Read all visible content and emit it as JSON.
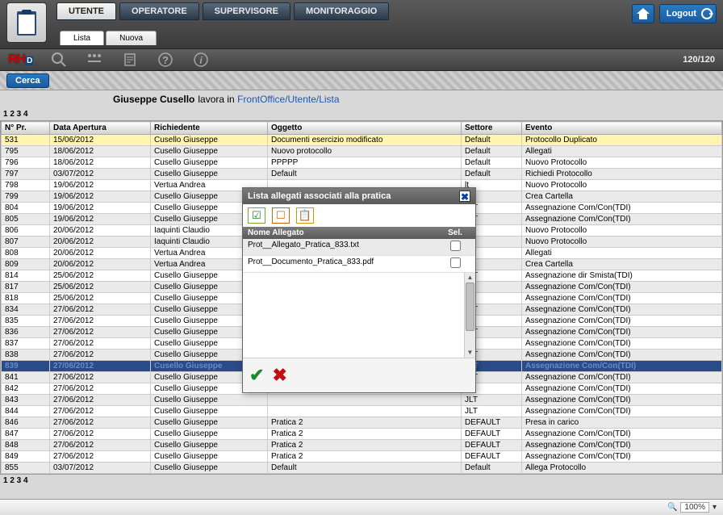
{
  "header": {
    "tabs": [
      "UTENTE",
      "OPERATORE",
      "SUPERVISORE",
      "MONITORAGGIO"
    ],
    "active_tab": 0,
    "logout": "Logout"
  },
  "sub_tabs": {
    "items": [
      "Lista",
      "Nuova"
    ],
    "active": 0
  },
  "rh_logo": {
    "a": "RH",
    "b": "D"
  },
  "counter": "120/120",
  "cerca": "Cerca",
  "context": {
    "user": "Giuseppe Cusello",
    "text": "lavora in",
    "path": "FrontOffice/Utente/Lista"
  },
  "pagination": "1 2 3 4",
  "columns": [
    "N° Pr.",
    "Data Apertura",
    "Richiedente",
    "Oggetto",
    "Settore",
    "Evento"
  ],
  "rows": [
    {
      "n": "531",
      "d": "15/06/2012",
      "r": "Cusello Giuseppe",
      "o": "Documenti esercizio modificato",
      "s": "Default",
      "e": "Protocollo Duplicato",
      "hl": "yellow"
    },
    {
      "n": "795",
      "d": "18/06/2012",
      "r": "Cusello Giuseppe",
      "o": "Nuovo protocollo",
      "s": "Default",
      "e": "Allegati"
    },
    {
      "n": "796",
      "d": "18/06/2012",
      "r": "Cusello Giuseppe",
      "o": "PPPPP",
      "s": "Default",
      "e": "Nuovo Protocollo"
    },
    {
      "n": "797",
      "d": "03/07/2012",
      "r": "Cusello Giuseppe",
      "o": "Default",
      "s": "Default",
      "e": "Richiedi Protocollo"
    },
    {
      "n": "798",
      "d": "19/06/2012",
      "r": "Vertua Andrea",
      "o": "",
      "s": "lt",
      "e": "Nuovo Protocollo"
    },
    {
      "n": "799",
      "d": "19/06/2012",
      "r": "Cusello Giuseppe",
      "o": "",
      "s": "lt",
      "e": "Crea Cartella"
    },
    {
      "n": "804",
      "d": "19/06/2012",
      "r": "Cusello Giuseppe",
      "o": "",
      "s": "JLT",
      "e": "Assegnazione Com/Con(TDI)"
    },
    {
      "n": "805",
      "d": "19/06/2012",
      "r": "Cusello Giuseppe",
      "o": "",
      "s": "JLT",
      "e": "Assegnazione Com/Con(TDI)"
    },
    {
      "n": "806",
      "d": "20/06/2012",
      "r": "Iaquinti Claudio",
      "o": "",
      "s": "lt",
      "e": "Nuovo Protocollo"
    },
    {
      "n": "807",
      "d": "20/06/2012",
      "r": "Iaquinti Claudio",
      "o": "",
      "s": "lt",
      "e": "Nuovo Protocollo"
    },
    {
      "n": "808",
      "d": "20/06/2012",
      "r": "Vertua Andrea",
      "o": "",
      "s": "lt",
      "e": "Allegati"
    },
    {
      "n": "809",
      "d": "20/06/2012",
      "r": "Vertua Andrea",
      "o": "",
      "s": "lt",
      "e": "Crea Cartella"
    },
    {
      "n": "814",
      "d": "25/06/2012",
      "r": "Cusello Giuseppe",
      "o": "",
      "s": "JLT",
      "e": "Assegnazione dir Smista(TDI)"
    },
    {
      "n": "817",
      "d": "25/06/2012",
      "r": "Cusello Giuseppe",
      "o": "",
      "s": "lt",
      "e": "Assegnazione Com/Con(TDI)"
    },
    {
      "n": "818",
      "d": "25/06/2012",
      "r": "Cusello Giuseppe",
      "o": "",
      "s": "lt",
      "e": "Assegnazione Com/Con(TDI)"
    },
    {
      "n": "834",
      "d": "27/06/2012",
      "r": "Cusello Giuseppe",
      "o": "",
      "s": "JLT",
      "e": "Assegnazione Com/Con(TDI)"
    },
    {
      "n": "835",
      "d": "27/06/2012",
      "r": "Cusello Giuseppe",
      "o": "",
      "s": "lt",
      "e": "Assegnazione Com/Con(TDI)"
    },
    {
      "n": "836",
      "d": "27/06/2012",
      "r": "Cusello Giuseppe",
      "o": "",
      "s": "JLT",
      "e": "Assegnazione Com/Con(TDI)"
    },
    {
      "n": "837",
      "d": "27/06/2012",
      "r": "Cusello Giuseppe",
      "o": "",
      "s": "lt",
      "e": "Assegnazione Com/Con(TDI)"
    },
    {
      "n": "838",
      "d": "27/06/2012",
      "r": "Cusello Giuseppe",
      "o": "",
      "s": "JLT",
      "e": "Assegnazione Com/Con(TDI)"
    },
    {
      "n": "839",
      "d": "27/06/2012",
      "r": "Cusello Giuseppe",
      "o": "",
      "s": "JLT",
      "e": "Assegnazione Com/Con(TDI)",
      "hl": "blue"
    },
    {
      "n": "841",
      "d": "27/06/2012",
      "r": "Cusello Giuseppe",
      "o": "",
      "s": "JLT",
      "e": "Assegnazione Com/Con(TDI)"
    },
    {
      "n": "842",
      "d": "27/06/2012",
      "r": "Cusello Giuseppe",
      "o": "",
      "s": "lt",
      "e": "Assegnazione Com/Con(TDI)"
    },
    {
      "n": "843",
      "d": "27/06/2012",
      "r": "Cusello Giuseppe",
      "o": "",
      "s": "JLT",
      "e": "Assegnazione Com/Con(TDI)"
    },
    {
      "n": "844",
      "d": "27/06/2012",
      "r": "Cusello Giuseppe",
      "o": "",
      "s": "JLT",
      "e": "Assegnazione Com/Con(TDI)"
    },
    {
      "n": "846",
      "d": "27/06/2012",
      "r": "Cusello Giuseppe",
      "o": "Pratica 2",
      "s": "DEFAULT",
      "e": "Presa in carico"
    },
    {
      "n": "847",
      "d": "27/06/2012",
      "r": "Cusello Giuseppe",
      "o": "Pratica 2",
      "s": "DEFAULT",
      "e": "Assegnazione Com/Con(TDI)"
    },
    {
      "n": "848",
      "d": "27/06/2012",
      "r": "Cusello Giuseppe",
      "o": "Pratica 2",
      "s": "DEFAULT",
      "e": "Assegnazione Com/Con(TDI)"
    },
    {
      "n": "849",
      "d": "27/06/2012",
      "r": "Cusello Giuseppe",
      "o": "Pratica 2",
      "s": "DEFAULT",
      "e": "Assegnazione Com/Con(TDI)"
    },
    {
      "n": "855",
      "d": "03/07/2012",
      "r": "Cusello Giuseppe",
      "o": "Default",
      "s": "Default",
      "e": "Allega Protocollo"
    }
  ],
  "dialog": {
    "title": "Lista allegati associati alla pratica",
    "col_name": "Nome Allegato",
    "col_sel": "Sel.",
    "attachments": [
      {
        "name": "Prot__Allegato_Pratica_833.txt",
        "sel": false
      },
      {
        "name": "Prot__Documento_Pratica_833.pdf",
        "sel": false
      }
    ]
  },
  "statusbar": {
    "zoom": "100%"
  }
}
